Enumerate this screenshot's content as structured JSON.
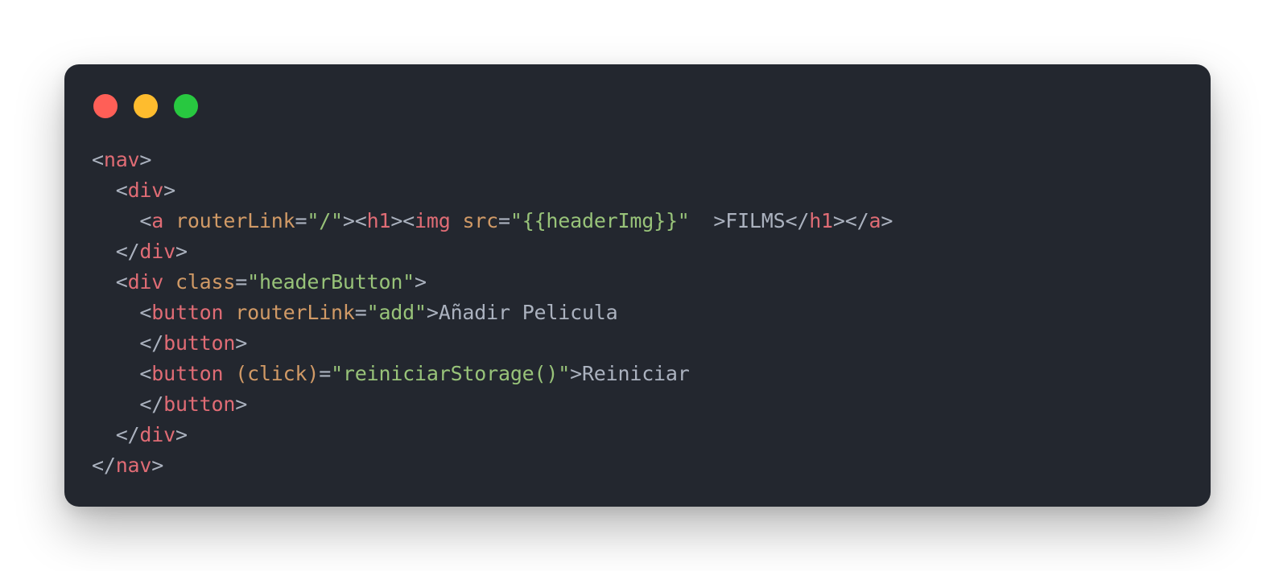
{
  "window": {
    "controls": [
      "close-button",
      "minimize-button",
      "zoom-button"
    ]
  },
  "colors": {
    "background": "#23272f",
    "punctuation": "#abb2bf",
    "tag": "#e06c75",
    "attribute": "#d19a66",
    "string": "#98c379",
    "text": "#abb2bf",
    "close": "#ff5f57",
    "minimize": "#febc2e",
    "zoom": "#28c840"
  },
  "code": {
    "lines": [
      [
        [
          "punct",
          "<"
        ],
        [
          "tag",
          "nav"
        ],
        [
          "punct",
          ">"
        ]
      ],
      [
        [
          "punct",
          "  <"
        ],
        [
          "tag",
          "div"
        ],
        [
          "punct",
          ">"
        ]
      ],
      [
        [
          "punct",
          "    <"
        ],
        [
          "tag",
          "a"
        ],
        [
          "punct",
          " "
        ],
        [
          "attr",
          "routerLink"
        ],
        [
          "punct",
          "="
        ],
        [
          "str",
          "\"/\""
        ],
        [
          "punct",
          "><"
        ],
        [
          "tag",
          "h1"
        ],
        [
          "punct",
          "><"
        ],
        [
          "tag",
          "img"
        ],
        [
          "punct",
          " "
        ],
        [
          "attr",
          "src"
        ],
        [
          "punct",
          "="
        ],
        [
          "str",
          "\"{{headerImg}}\""
        ],
        [
          "punct",
          "  >"
        ],
        [
          "text",
          "FILMS"
        ],
        [
          "punct",
          "</"
        ],
        [
          "tag",
          "h1"
        ],
        [
          "punct",
          "></"
        ],
        [
          "tag",
          "a"
        ],
        [
          "punct",
          ">"
        ]
      ],
      [
        [
          "punct",
          "  </"
        ],
        [
          "tag",
          "div"
        ],
        [
          "punct",
          ">"
        ]
      ],
      [
        [
          "punct",
          "  <"
        ],
        [
          "tag",
          "div"
        ],
        [
          "punct",
          " "
        ],
        [
          "attr",
          "class"
        ],
        [
          "punct",
          "="
        ],
        [
          "str",
          "\"headerButton\""
        ],
        [
          "punct",
          ">"
        ]
      ],
      [
        [
          "punct",
          "    <"
        ],
        [
          "tag",
          "button"
        ],
        [
          "punct",
          " "
        ],
        [
          "attr",
          "routerLink"
        ],
        [
          "punct",
          "="
        ],
        [
          "str",
          "\"add\""
        ],
        [
          "punct",
          ">"
        ],
        [
          "text",
          "Añadir Pelicula"
        ]
      ],
      [
        [
          "punct",
          "    </"
        ],
        [
          "tag",
          "button"
        ],
        [
          "punct",
          ">"
        ]
      ],
      [
        [
          "punct",
          "    <"
        ],
        [
          "tag",
          "button"
        ],
        [
          "punct",
          " "
        ],
        [
          "attr",
          "(click)"
        ],
        [
          "punct",
          "="
        ],
        [
          "str",
          "\"reiniciarStorage()\""
        ],
        [
          "punct",
          ">"
        ],
        [
          "text",
          "Reiniciar"
        ]
      ],
      [
        [
          "punct",
          "    </"
        ],
        [
          "tag",
          "button"
        ],
        [
          "punct",
          ">"
        ]
      ],
      [
        [
          "punct",
          "  </"
        ],
        [
          "tag",
          "div"
        ],
        [
          "punct",
          ">"
        ]
      ],
      [
        [
          "punct",
          "</"
        ],
        [
          "tag",
          "nav"
        ],
        [
          "punct",
          ">"
        ]
      ]
    ]
  }
}
